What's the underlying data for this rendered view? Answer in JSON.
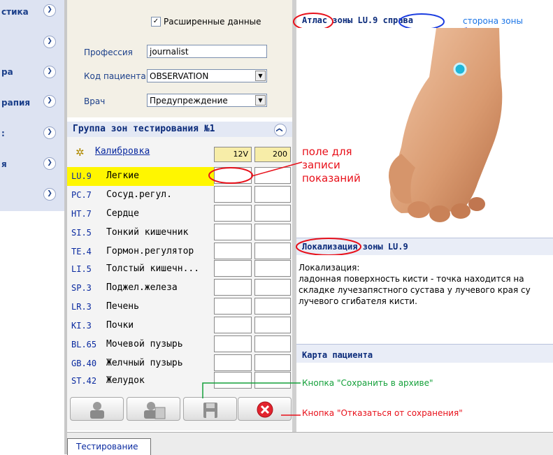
{
  "nav": {
    "items": [
      {
        "label": "стика"
      },
      {
        "label": ""
      },
      {
        "label": "ра"
      },
      {
        "label": "рапия"
      },
      {
        "label": ":"
      },
      {
        "label": "я"
      },
      {
        "label": ""
      }
    ]
  },
  "form": {
    "extended_label": "Расширенные данные",
    "profession_label": "Профессия",
    "profession_value": "journalist",
    "patient_code_label": "Код пациента",
    "patient_code_value": "OBSERVATION",
    "doctor_label": "Врач",
    "doctor_value": "Предупреждение"
  },
  "group": {
    "title": "Группа зон тестирования №1",
    "calibration_label": "Калибровка",
    "col1": "12V",
    "col2": "200",
    "zones": [
      {
        "code": "LU.9",
        "name": "Легкие"
      },
      {
        "code": "PC.7",
        "name": "Сосуд.регул."
      },
      {
        "code": "HT.7",
        "name": "Сердце"
      },
      {
        "code": "SI.5",
        "name": "Тонкий кишечник"
      },
      {
        "code": "TE.4",
        "name": "Гормон.регулятор"
      },
      {
        "code": "LI.5",
        "name": "Толстый кишечн..."
      },
      {
        "code": "SP.3",
        "name": "Поджел.железа"
      },
      {
        "code": "LR.3",
        "name": "Печень"
      },
      {
        "code": "KI.3",
        "name": "Почки"
      },
      {
        "code": "BL.65",
        "name": "Мочевой пузырь"
      },
      {
        "code": "GB.40",
        "name": "Желчный пузырь"
      },
      {
        "code": "ST.42",
        "name": "Желудок"
      }
    ]
  },
  "atlas": {
    "title": "Атлас зоны LU.9 справа",
    "side_note": "сторона зоны тестирования !"
  },
  "localization": {
    "title": "Локализация зоны LU.9",
    "label": "Локализация:",
    "line1": "ладонная поверхность кисти - точка находится на",
    "line2": "складке лучезапястного сустава у лучевого края су",
    "line3": "лучевого сгибателя кисти."
  },
  "card": {
    "title": "Карта пациента"
  },
  "annotations": {
    "field_note_1": "поле для",
    "field_note_2": "записи",
    "field_note_3": "показаний",
    "save_note": "Кнопка \"Сохранить в архиве\"",
    "cancel_note": "Кнопка \"Отказаться от сохранения\""
  },
  "tabs": {
    "testing": "Тестирование"
  }
}
